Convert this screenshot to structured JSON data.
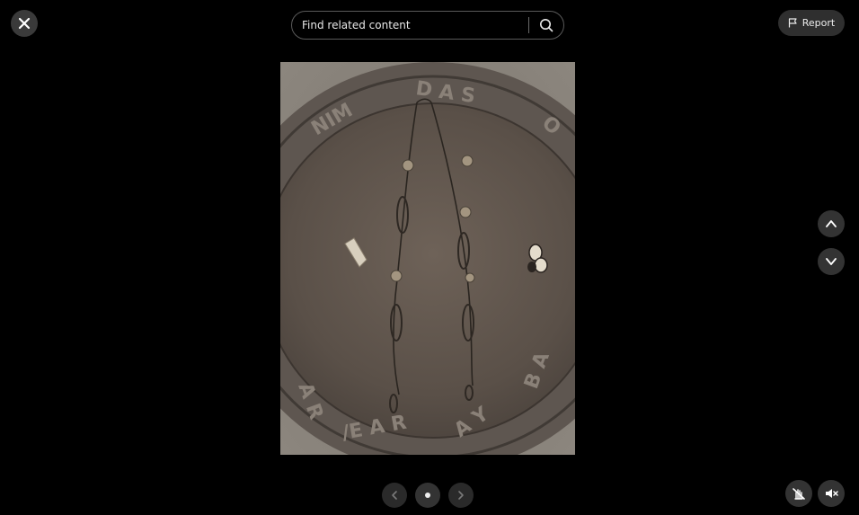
{
  "search": {
    "placeholder": "Find related content"
  },
  "header": {
    "report_label": "Report"
  },
  "image": {
    "icon": "photo-of-necklace-on-carved-wooden-tray"
  },
  "icons": {
    "close": "close-icon",
    "search": "search-icon",
    "report": "flag-icon",
    "previous_item": "chevron-up-icon",
    "next_item": "chevron-down-icon",
    "carousel_prev": "chevron-left-icon",
    "carousel_next": "chevron-right-icon",
    "no_ads": "hand-crossed-icon",
    "mute": "speaker-muted-icon"
  },
  "carousel": {
    "page_count": 1,
    "active_index": 0
  },
  "colors": {
    "background": "#000000",
    "control_bg": "#333333",
    "icon": "#ffffff"
  }
}
